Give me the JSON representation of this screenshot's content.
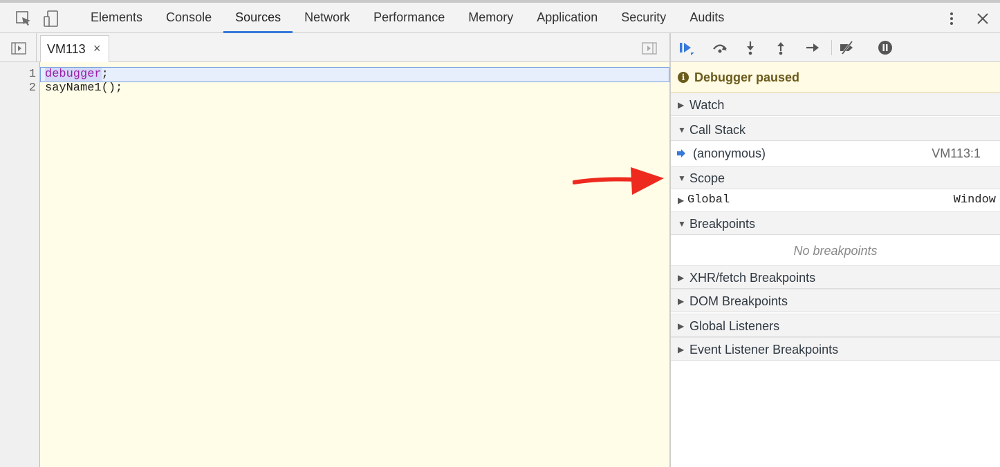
{
  "toolbar": {
    "tabs": [
      "Elements",
      "Console",
      "Sources",
      "Network",
      "Performance",
      "Memory",
      "Application",
      "Security",
      "Audits"
    ],
    "active_tab": "Sources",
    "icons": [
      "inspect-element-icon",
      "device-toggle-icon",
      "kebab-menu-icon",
      "close-icon"
    ]
  },
  "editor": {
    "file_tab": "VM113",
    "file_tab_close": "×",
    "lines": [
      {
        "num": "1",
        "keyword": "debugger",
        "rest": ";"
      },
      {
        "num": "2",
        "text": "sayName1();"
      }
    ],
    "background_color": "#fffde8"
  },
  "debugger": {
    "controls": [
      "resume-icon",
      "step-over-icon",
      "step-into-icon",
      "step-out-icon",
      "step-icon",
      "deactivate-breakpoints-icon",
      "pause-on-exceptions-icon"
    ],
    "paused_message": "Debugger paused",
    "sections": {
      "watch": "Watch",
      "call_stack": "Call Stack",
      "scope": "Scope",
      "breakpoints": "Breakpoints",
      "xhr": "XHR/fetch Breakpoints",
      "dom": "DOM Breakpoints",
      "global_listeners": "Global Listeners",
      "event_listeners": "Event Listener Breakpoints"
    },
    "call_stack_frame": {
      "name": "(anonymous)",
      "location": "VM113:1"
    },
    "scope_global": {
      "name": "Global",
      "value": "Window"
    },
    "no_breakpoints": "No breakpoints"
  },
  "colors": {
    "accent": "#3879d9",
    "paused_bg": "#fffbe4",
    "paused_text": "#6b5b1c",
    "annotation_arrow": "#ee2a1f"
  }
}
